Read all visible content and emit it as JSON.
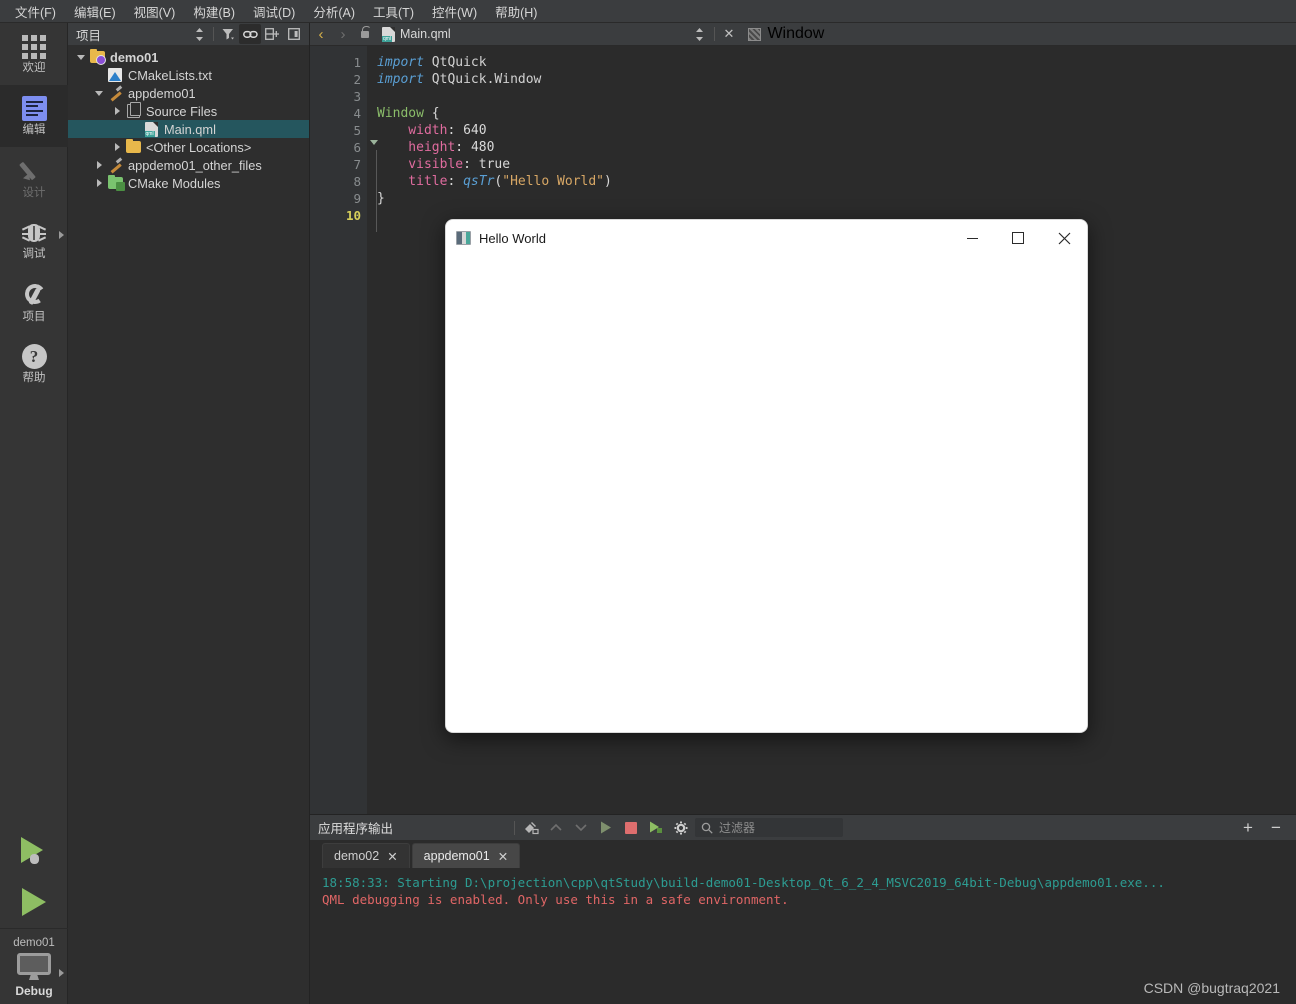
{
  "menubar": {
    "items": [
      {
        "label": "文件(F)",
        "name": "menu-file"
      },
      {
        "label": "编辑(E)",
        "name": "menu-edit"
      },
      {
        "label": "视图(V)",
        "name": "menu-view"
      },
      {
        "label": "构建(B)",
        "name": "menu-build"
      },
      {
        "label": "调试(D)",
        "name": "menu-debug"
      },
      {
        "label": "分析(A)",
        "name": "menu-analyze"
      },
      {
        "label": "工具(T)",
        "name": "menu-tools"
      },
      {
        "label": "控件(W)",
        "name": "menu-window"
      },
      {
        "label": "帮助(H)",
        "name": "menu-help"
      }
    ]
  },
  "modebar": {
    "modes": [
      {
        "label": "欢迎",
        "icon": "grid-icon",
        "active": false,
        "disabled": false
      },
      {
        "label": "编辑",
        "icon": "edit-icon",
        "active": true,
        "disabled": false
      },
      {
        "label": "设计",
        "icon": "pencil-icon",
        "active": false,
        "disabled": true
      },
      {
        "label": "调试",
        "icon": "bug-icon",
        "active": false,
        "disabled": false
      },
      {
        "label": "项目",
        "icon": "wrench-icon",
        "active": false,
        "disabled": false
      },
      {
        "label": "帮助",
        "icon": "question-icon",
        "active": false,
        "disabled": false
      }
    ],
    "kit": {
      "project": "demo01",
      "build_config": "Debug",
      "icon": "monitor-icon"
    },
    "run_button": "run-icon",
    "debug_button": "run-debug-icon"
  },
  "tree_panel": {
    "title": "项目",
    "toolbar": [
      {
        "name": "sort-toggle-icon",
        "glyph": "⇅"
      },
      {
        "name": "filter-icon",
        "glyph": "▼"
      },
      {
        "name": "link-with-editor-icon",
        "glyph": "⚭",
        "active": true
      },
      {
        "name": "expand-all-icon",
        "glyph": "⊞"
      },
      {
        "name": "split-icon",
        "glyph": "◨"
      }
    ],
    "items": [
      {
        "label": "demo01",
        "icon": "folder-project-icon",
        "indent": 0,
        "expander": "down",
        "bold": true,
        "selected": false
      },
      {
        "label": "CMakeLists.txt",
        "icon": "cmake-file-icon",
        "indent": 1,
        "expander": "none",
        "bold": false,
        "selected": false
      },
      {
        "label": "appdemo01",
        "icon": "build-target-icon",
        "indent": 1,
        "expander": "down",
        "bold": false,
        "selected": false
      },
      {
        "label": "Source Files",
        "icon": "source-files-icon",
        "indent": 2,
        "expander": "right",
        "bold": false,
        "selected": false
      },
      {
        "label": "Main.qml",
        "icon": "qml-file-icon",
        "indent": 3,
        "expander": "none",
        "bold": false,
        "selected": true
      },
      {
        "label": "<Other Locations>",
        "icon": "folder-icon",
        "indent": 2,
        "expander": "right",
        "bold": false,
        "selected": false
      },
      {
        "label": "appdemo01_other_files",
        "icon": "build-target-icon",
        "indent": 1,
        "expander": "right",
        "bold": false,
        "selected": false
      },
      {
        "label": "CMake Modules",
        "icon": "folder-modules-icon",
        "indent": 1,
        "expander": "right",
        "bold": false,
        "selected": false
      }
    ]
  },
  "editor": {
    "nav": {
      "back": "‹",
      "forward": "›",
      "lock": "unlock-icon"
    },
    "open_file": "Main.qml",
    "open_file_icon": "qml-file-icon",
    "dropdown": "⇅",
    "close": "✕",
    "side_item": {
      "label": "Window",
      "icon": "hatch-icon"
    },
    "lines": [
      {
        "n": "1",
        "tokens": [
          {
            "t": "import ",
            "c": "k-import"
          },
          {
            "t": "QtQuick",
            "c": "k-mod"
          }
        ]
      },
      {
        "n": "2",
        "tokens": [
          {
            "t": "import ",
            "c": "k-import"
          },
          {
            "t": "QtQuick.Window",
            "c": "k-mod"
          }
        ]
      },
      {
        "n": "3",
        "tokens": []
      },
      {
        "n": "4",
        "tokens": [
          {
            "t": "Window ",
            "c": "k-type"
          },
          {
            "t": "{",
            "c": "k-pl"
          }
        ]
      },
      {
        "n": "5",
        "tokens": [
          {
            "t": "    width",
            "c": "k-prop"
          },
          {
            "t": ": ",
            "c": "k-pl"
          },
          {
            "t": "640",
            "c": "k-num"
          }
        ]
      },
      {
        "n": "6",
        "tokens": [
          {
            "t": "    height",
            "c": "k-prop"
          },
          {
            "t": ": ",
            "c": "k-pl"
          },
          {
            "t": "480",
            "c": "k-num"
          }
        ]
      },
      {
        "n": "7",
        "tokens": [
          {
            "t": "    visible",
            "c": "k-prop"
          },
          {
            "t": ": ",
            "c": "k-pl"
          },
          {
            "t": "true",
            "c": "k-num"
          }
        ]
      },
      {
        "n": "8",
        "tokens": [
          {
            "t": "    title",
            "c": "k-prop"
          },
          {
            "t": ": ",
            "c": "k-pl"
          },
          {
            "t": "qsTr",
            "c": "k-func"
          },
          {
            "t": "(",
            "c": "k-pl"
          },
          {
            "t": "\"Hello World\"",
            "c": "k-str"
          },
          {
            "t": ")",
            "c": "k-pl"
          }
        ]
      },
      {
        "n": "9",
        "tokens": [
          {
            "t": "}",
            "c": "k-pl"
          }
        ]
      },
      {
        "n": "10",
        "tokens": [],
        "current": true
      }
    ]
  },
  "app_window": {
    "title": "Hello World",
    "icon": "app-icon",
    "buttons": [
      {
        "name": "minimize-button",
        "glyph": "–"
      },
      {
        "name": "maximize-button",
        "glyph": "☐"
      },
      {
        "name": "close-button",
        "glyph": "✕"
      }
    ]
  },
  "output_pane": {
    "title": "应用程序输出",
    "toolbar": [
      {
        "name": "clear-output-icon",
        "glyph": "⌧"
      },
      {
        "name": "prev-item-icon",
        "glyph": "∧"
      },
      {
        "name": "next-item-icon",
        "glyph": "∨"
      },
      {
        "name": "run-icon",
        "glyph": "▶"
      },
      {
        "name": "stop-icon",
        "glyph": "■"
      },
      {
        "name": "attach-debugger-icon",
        "glyph": "▶"
      },
      {
        "name": "settings-gear-icon",
        "glyph": "⚙"
      }
    ],
    "filter": {
      "placeholder": "过滤器",
      "value": "",
      "icon": "search-icon"
    },
    "maximize": "+",
    "minimize": "−",
    "tabs": [
      {
        "label": "demo02",
        "active": false,
        "close": "✕"
      },
      {
        "label": "appdemo01",
        "active": true,
        "close": "✕"
      }
    ],
    "log": [
      {
        "text": "18:58:33: Starting D:\\projection\\cpp\\qtStudy\\build-demo01-Desktop_Qt_6_2_4_MSVC2019_64bit-Debug\\appdemo01.exe...",
        "color": "teal"
      },
      {
        "text": "QML debugging is enabled. Only use this in a safe environment.",
        "color": "red"
      }
    ]
  },
  "watermark": "CSDN @bugtraq2021",
  "colors": {
    "menubar_bg": "#3b3d3f",
    "panel_bg": "#2e2e2e",
    "editor_bg": "#2b2b2b",
    "selection": "#25565e",
    "accent_blue": "#7d8ef0",
    "run_green": "#8ebe63",
    "log_teal": "#2d9c92",
    "log_red": "#e06666",
    "current_line_number": "#d6cf5a"
  }
}
